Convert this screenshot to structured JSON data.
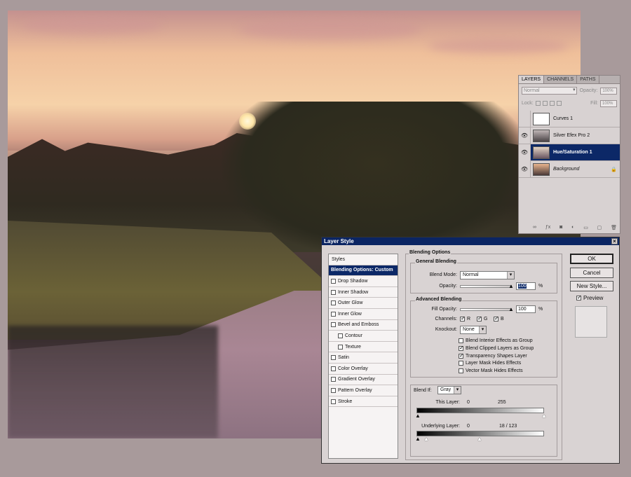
{
  "layers_panel": {
    "tabs": [
      "LAYERS",
      "CHANNELS",
      "PATHS"
    ],
    "blend_mode": "Normal",
    "opacity_label": "Opacity:",
    "opacity_value": "100%",
    "lock_label": "Lock:",
    "fill_label": "Fill:",
    "fill_value": "100%",
    "layers": [
      {
        "name": "Curves 1",
        "visible": false,
        "selected": false
      },
      {
        "name": "Silver Efex Pro 2",
        "visible": true,
        "selected": false
      },
      {
        "name": "Hue/Saturation 1",
        "visible": true,
        "selected": true
      },
      {
        "name": "Background",
        "visible": true,
        "selected": false,
        "locked": true
      }
    ]
  },
  "dialog": {
    "title": "Layer Style",
    "styles_header": "Styles",
    "styles": [
      {
        "label": "Blending Options: Custom",
        "active": true,
        "checkbox": false,
        "sub": false
      },
      {
        "label": "Drop Shadow",
        "checkbox": true,
        "sub": false
      },
      {
        "label": "Inner Shadow",
        "checkbox": true,
        "sub": false
      },
      {
        "label": "Outer Glow",
        "checkbox": true,
        "sub": false
      },
      {
        "label": "Inner Glow",
        "checkbox": true,
        "sub": false
      },
      {
        "label": "Bevel and Emboss",
        "checkbox": true,
        "sub": false
      },
      {
        "label": "Contour",
        "checkbox": true,
        "sub": true
      },
      {
        "label": "Texture",
        "checkbox": true,
        "sub": true
      },
      {
        "label": "Satin",
        "checkbox": true,
        "sub": false
      },
      {
        "label": "Color Overlay",
        "checkbox": true,
        "sub": false
      },
      {
        "label": "Gradient Overlay",
        "checkbox": true,
        "sub": false
      },
      {
        "label": "Pattern Overlay",
        "checkbox": true,
        "sub": false
      },
      {
        "label": "Stroke",
        "checkbox": true,
        "sub": false
      }
    ],
    "blending_options": {
      "title": "Blending Options",
      "general": {
        "title": "General Blending",
        "blend_mode_label": "Blend Mode:",
        "blend_mode": "Normal",
        "opacity_label": "Opacity:",
        "opacity": "100",
        "opacity_unit": "%"
      },
      "advanced": {
        "title": "Advanced Blending",
        "fill_opacity_label": "Fill Opacity:",
        "fill_opacity": "100",
        "fill_unit": "%",
        "channels_label": "Channels:",
        "channels": [
          "R",
          "G",
          "B"
        ],
        "knockout_label": "Knockout:",
        "knockout": "None",
        "options": [
          {
            "label": "Blend Interior Effects as Group",
            "checked": false
          },
          {
            "label": "Blend Clipped Layers as Group",
            "checked": true
          },
          {
            "label": "Transparency Shapes Layer",
            "checked": true
          },
          {
            "label": "Layer Mask Hides Effects",
            "checked": false
          },
          {
            "label": "Vector Mask Hides Effects",
            "checked": false
          }
        ]
      },
      "blend_if": {
        "label": "Blend If:",
        "value": "Gray",
        "this_layer_label": "This Layer:",
        "this_layer_low": "0",
        "this_layer_high": "255",
        "underlying_label": "Underlying Layer:",
        "underlying_low": "0",
        "underlying_high": "18  /  123"
      }
    },
    "buttons": {
      "ok": "OK",
      "cancel": "Cancel",
      "new_style": "New Style...",
      "preview": "Preview"
    }
  }
}
